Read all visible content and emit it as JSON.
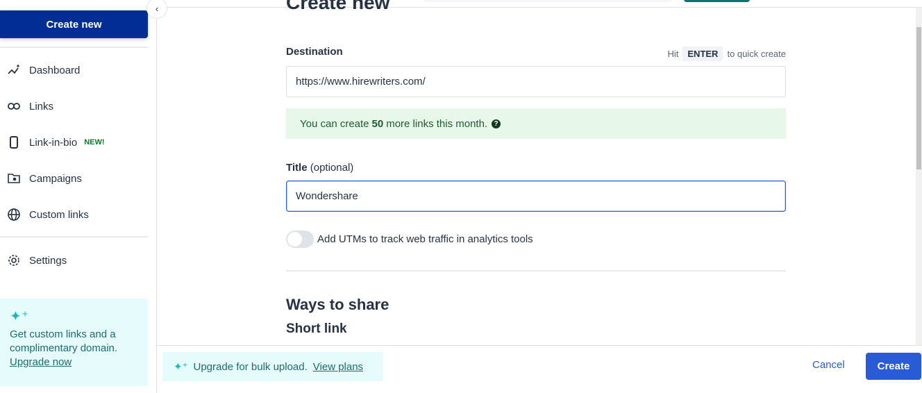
{
  "sidebar": {
    "create_label": "Create new",
    "items": [
      {
        "label": "Dashboard",
        "icon": "dashboard-icon"
      },
      {
        "label": "Links",
        "icon": "link-icon"
      },
      {
        "label": "Link-in-bio",
        "icon": "phone-icon",
        "badge": "NEW!"
      },
      {
        "label": "Campaigns",
        "icon": "folder-star-icon"
      },
      {
        "label": "Custom links",
        "icon": "globe-icon"
      },
      {
        "label": "Settings",
        "icon": "gear-icon"
      }
    ],
    "promo": {
      "text": "Get custom links and a complimentary domain.",
      "link": "Upgrade now"
    }
  },
  "main": {
    "title": "Create new",
    "destination_label": "Destination",
    "hint_pre": "Hit",
    "hint_key": "ENTER",
    "hint_post": "to quick create",
    "destination_value": "https://www.hirewriters.com/",
    "notice_pre": "You can create",
    "notice_count": "50",
    "notice_post": "more links this month.",
    "title_label": "Title",
    "title_optional": "(optional)",
    "title_value": "Wondershare",
    "utm_label": "Add UTMs to track web traffic in analytics tools",
    "utm_enabled": false,
    "share_heading": "Ways to share",
    "short_link_heading": "Short link"
  },
  "footer": {
    "bulk_text": "Upgrade for bulk upload.",
    "bulk_link": "View plans",
    "cancel": "Cancel",
    "create": "Create"
  },
  "colors": {
    "primary": "#022d94",
    "accent": "#2a5bd7",
    "teal": "#1c6b6f",
    "success_bg": "#e7f8ea"
  }
}
